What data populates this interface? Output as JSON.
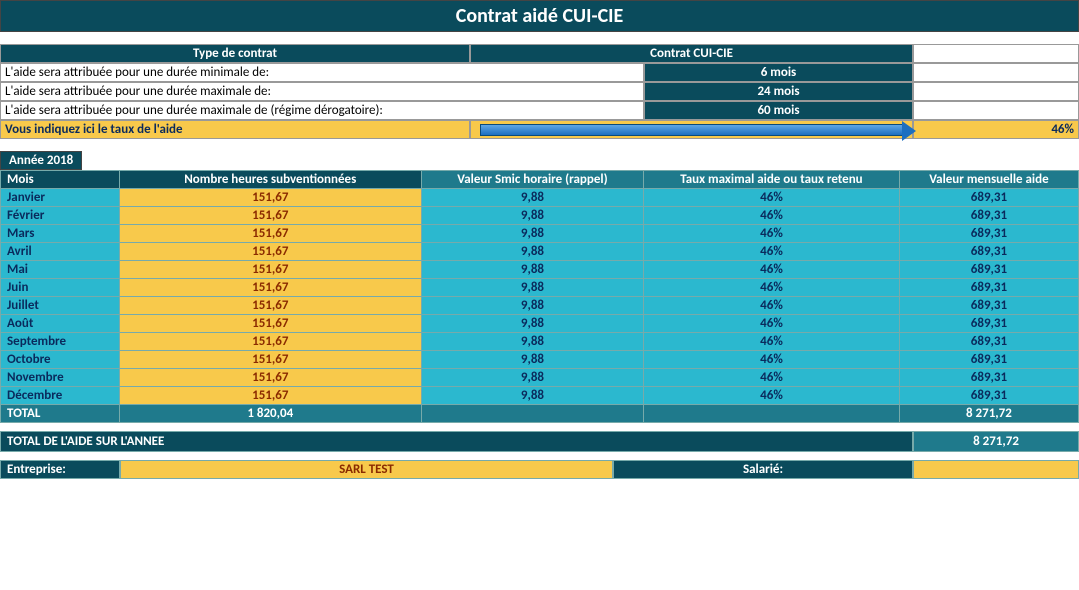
{
  "title": "Contrat aidé CUI-CIE",
  "header": {
    "type_contrat": "Type de contrat",
    "contrat": "Contrat CUI-CIE"
  },
  "durees": [
    {
      "label": "L'aide sera attribuée pour une durée minimale de:",
      "val": "6 mois"
    },
    {
      "label": "L'aide sera attribuée pour une durée maximale de:",
      "val": "24 mois"
    },
    {
      "label": "L'aide sera attribuée pour une durée maximale de (régime dérogatoire):",
      "val": "60 mois"
    }
  ],
  "taux": {
    "label": "Vous indiquez ici le taux de l'aide",
    "val": "46%"
  },
  "annee": "Année 2018",
  "cols": {
    "mois": "Mois",
    "heures": "Nombre heures subventionnées",
    "smic": "Valeur Smic horaire (rappel)",
    "taux": "Taux maximal aide ou taux retenu",
    "valeur": "Valeur mensuelle aide"
  },
  "months": [
    {
      "m": "Janvier",
      "h": "151,67",
      "s": "9,88",
      "t": "46%",
      "v": "689,31"
    },
    {
      "m": "Février",
      "h": "151,67",
      "s": "9,88",
      "t": "46%",
      "v": "689,31"
    },
    {
      "m": "Mars",
      "h": "151,67",
      "s": "9,88",
      "t": "46%",
      "v": "689,31"
    },
    {
      "m": "Avril",
      "h": "151,67",
      "s": "9,88",
      "t": "46%",
      "v": "689,31"
    },
    {
      "m": "Mai",
      "h": "151,67",
      "s": "9,88",
      "t": "46%",
      "v": "689,31"
    },
    {
      "m": "Juin",
      "h": "151,67",
      "s": "9,88",
      "t": "46%",
      "v": "689,31"
    },
    {
      "m": "Juillet",
      "h": "151,67",
      "s": "9,88",
      "t": "46%",
      "v": "689,31"
    },
    {
      "m": "Août",
      "h": "151,67",
      "s": "9,88",
      "t": "46%",
      "v": "689,31"
    },
    {
      "m": "Septembre",
      "h": "151,67",
      "s": "9,88",
      "t": "46%",
      "v": "689,31"
    },
    {
      "m": "Octobre",
      "h": "151,67",
      "s": "9,88",
      "t": "46%",
      "v": "689,31"
    },
    {
      "m": "Novembre",
      "h": "151,67",
      "s": "9,88",
      "t": "46%",
      "v": "689,31"
    },
    {
      "m": "Décembre",
      "h": "151,67",
      "s": "9,88",
      "t": "46%",
      "v": "689,31"
    }
  ],
  "total_row": {
    "label": "TOTAL",
    "heures": "1 820,04",
    "valeur": "8 271,72"
  },
  "total_annee": {
    "label": "TOTAL DE L'AIDE SUR L'ANNEE",
    "val": "8 271,72"
  },
  "footer": {
    "entreprise_label": "Entreprise:",
    "entreprise": "SARL TEST",
    "salarie_label": "Salarié:",
    "salarie": ""
  }
}
